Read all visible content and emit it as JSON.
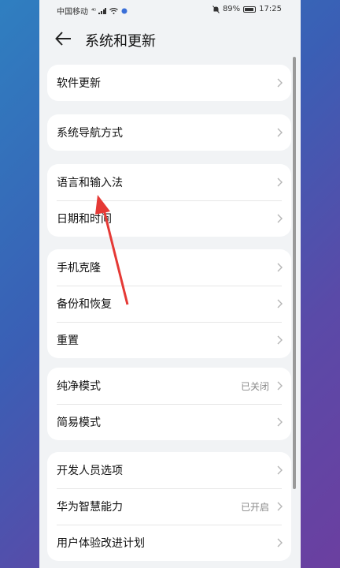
{
  "status": {
    "carrier": "中国移动",
    "network": "⁴ᴳ",
    "battery": "89%",
    "time": "17:25"
  },
  "header": {
    "title": "系统和更新"
  },
  "groups": [
    {
      "items": [
        {
          "label": "软件更新"
        }
      ]
    },
    {
      "items": [
        {
          "label": "系统导航方式"
        }
      ]
    },
    {
      "items": [
        {
          "label": "语言和输入法"
        },
        {
          "label": "日期和时间"
        }
      ]
    },
    {
      "items": [
        {
          "label": "手机克隆"
        },
        {
          "label": "备份和恢复"
        },
        {
          "label": "重置"
        }
      ]
    },
    {
      "items": [
        {
          "label": "纯净模式",
          "value": "已关闭"
        },
        {
          "label": "简易模式"
        }
      ]
    },
    {
      "items": [
        {
          "label": "开发人员选项"
        },
        {
          "label": "华为智慧能力",
          "value": "已开启"
        },
        {
          "label": "用户体验改进计划"
        }
      ]
    }
  ],
  "annotation": {
    "arrow_color": "#e53935"
  }
}
